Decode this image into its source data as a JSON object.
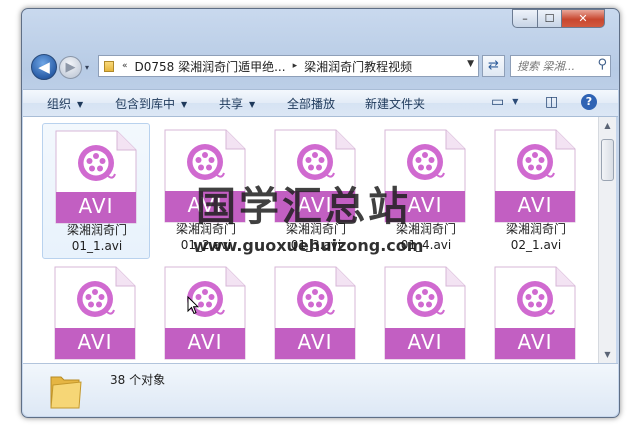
{
  "window": {
    "controls": {
      "minimize": "–",
      "maximize": "☐",
      "close": "✕"
    }
  },
  "nav": {
    "back_glyph": "◀",
    "forward_glyph": "▶",
    "dropdown_glyph": "▾"
  },
  "address": {
    "overflow": "«",
    "segments": [
      "D0758 梁湘润奇门遁甲绝...",
      "梁湘润奇门教程视频"
    ],
    "separator": "▸"
  },
  "search": {
    "placeholder": "搜索 梁湘..."
  },
  "toolbar": {
    "organize": "组织",
    "include_in_library": "包含到库中",
    "share": "共享",
    "play_all": "全部播放",
    "new_folder": "新建文件夹"
  },
  "files": [
    {
      "badge": "AVI",
      "name_line1": "梁湘润奇门",
      "name_line2": "01_1.avi"
    },
    {
      "badge": "AVI",
      "name_line1": "梁湘润奇门",
      "name_line2": "01_2.avi"
    },
    {
      "badge": "AVI",
      "name_line1": "梁湘润奇门",
      "name_line2": "01_3.avi"
    },
    {
      "badge": "AVI",
      "name_line1": "梁湘润奇门",
      "name_line2": "01_4.avi"
    },
    {
      "badge": "AVI",
      "name_line1": "梁湘润奇门",
      "name_line2": "02_1.avi"
    },
    {
      "badge": "AVI",
      "name_line1": "",
      "name_line2": ""
    },
    {
      "badge": "AVI",
      "name_line1": "",
      "name_line2": ""
    },
    {
      "badge": "AVI",
      "name_line1": "",
      "name_line2": ""
    },
    {
      "badge": "AVI",
      "name_line1": "",
      "name_line2": ""
    },
    {
      "badge": "AVI",
      "name_line1": "",
      "name_line2": ""
    }
  ],
  "status": {
    "count": "38 个对象"
  },
  "watermark": {
    "title": "国学汇总站",
    "url": "www.guoxuehuizong.com"
  },
  "colors": {
    "avi_accent": "#c25fc2",
    "avi_ring": "#d06ad0"
  }
}
